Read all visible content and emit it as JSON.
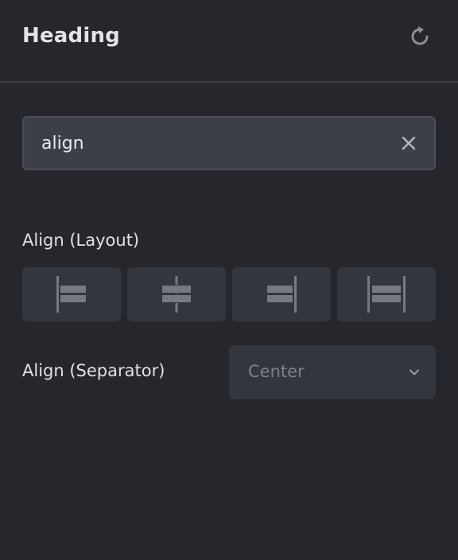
{
  "panel": {
    "title": "Heading",
    "reset_icon": "refresh-icon"
  },
  "search": {
    "value": "align",
    "clear_icon": "close-icon"
  },
  "align_layout": {
    "label": "Align (Layout)",
    "options": [
      {
        "icon": "align-left-icon"
      },
      {
        "icon": "align-center-icon"
      },
      {
        "icon": "align-right-icon"
      },
      {
        "icon": "align-justify-icon"
      }
    ]
  },
  "align_separator": {
    "label": "Align (Separator)",
    "selected": "Center",
    "chevron_icon": "chevron-down-icon"
  },
  "colors": {
    "background": "#25272c",
    "control_bg": "#33363c",
    "input_bg": "#3c3f45",
    "icon": "#7c8088"
  }
}
